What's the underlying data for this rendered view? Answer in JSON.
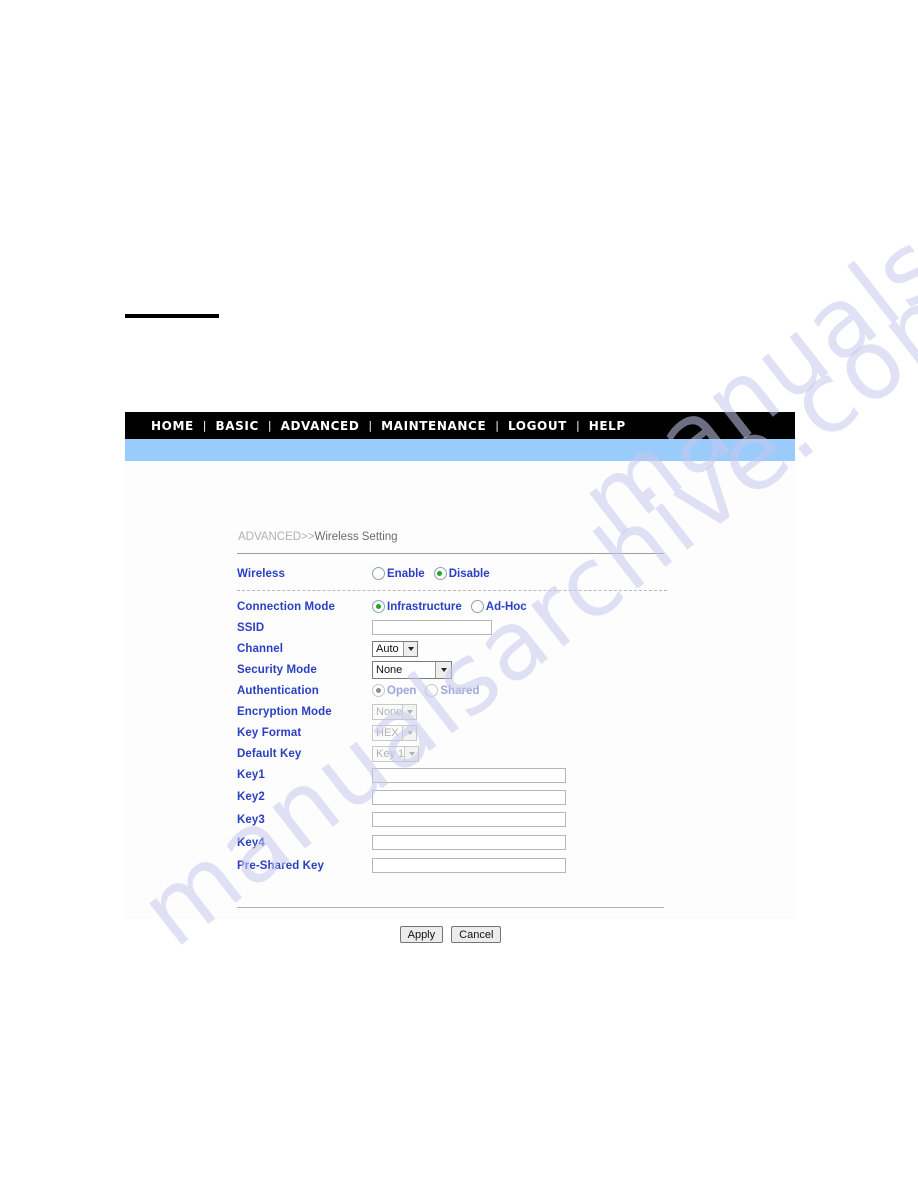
{
  "nav": {
    "separator": "|",
    "items": [
      {
        "label": "HOME"
      },
      {
        "label": "BASIC"
      },
      {
        "label": "ADVANCED"
      },
      {
        "label": "MAINTENANCE"
      },
      {
        "label": "LOGOUT"
      },
      {
        "label": "HELP"
      }
    ]
  },
  "breadcrumb": {
    "parent": "ADVANCED>>",
    "current": "Wireless Setting"
  },
  "form": {
    "wireless": {
      "label": "Wireless",
      "options": [
        {
          "label": "Enable",
          "selected": false
        },
        {
          "label": "Disable",
          "selected": true
        }
      ]
    },
    "connection_mode": {
      "label": "Connection Mode",
      "options": [
        {
          "label": "Infrastructure",
          "selected": true
        },
        {
          "label": "Ad-Hoc",
          "selected": false
        }
      ]
    },
    "ssid": {
      "label": "SSID",
      "value": "",
      "placeholder": ""
    },
    "channel": {
      "label": "Channel",
      "value": "Auto"
    },
    "security_mode": {
      "label": "Security Mode",
      "value": "None"
    },
    "authentication": {
      "label": "Authentication",
      "options": [
        {
          "label": "Open",
          "selected": true
        },
        {
          "label": "Shared",
          "selected": false
        }
      ]
    },
    "encryption_mode": {
      "label": "Encryption Mode",
      "value": "None"
    },
    "key_format": {
      "label": "Key Format",
      "value": "HEX"
    },
    "default_key": {
      "label": "Default Key",
      "value": "Key 1"
    },
    "key1": {
      "label": "Key1",
      "value": "",
      "placeholder": ""
    },
    "key2": {
      "label": "Key2",
      "value": "",
      "placeholder": ""
    },
    "key3": {
      "label": "Key3",
      "value": "",
      "placeholder": ""
    },
    "key4": {
      "label": "Key4",
      "value": "",
      "placeholder": ""
    },
    "pre_shared_key": {
      "label": "Pre-Shared Key",
      "value": "",
      "placeholder": ""
    }
  },
  "buttons": {
    "apply": "Apply",
    "cancel": "Cancel"
  },
  "watermark": {
    "text_a": "manualsarchive.com",
    "text_b": "manualsarchive.com"
  },
  "colors": {
    "nav_bg": "#000000",
    "band_blue": "#99cbfb",
    "label_blue": "#2a3fc2",
    "radio_green": "#1da81d"
  }
}
